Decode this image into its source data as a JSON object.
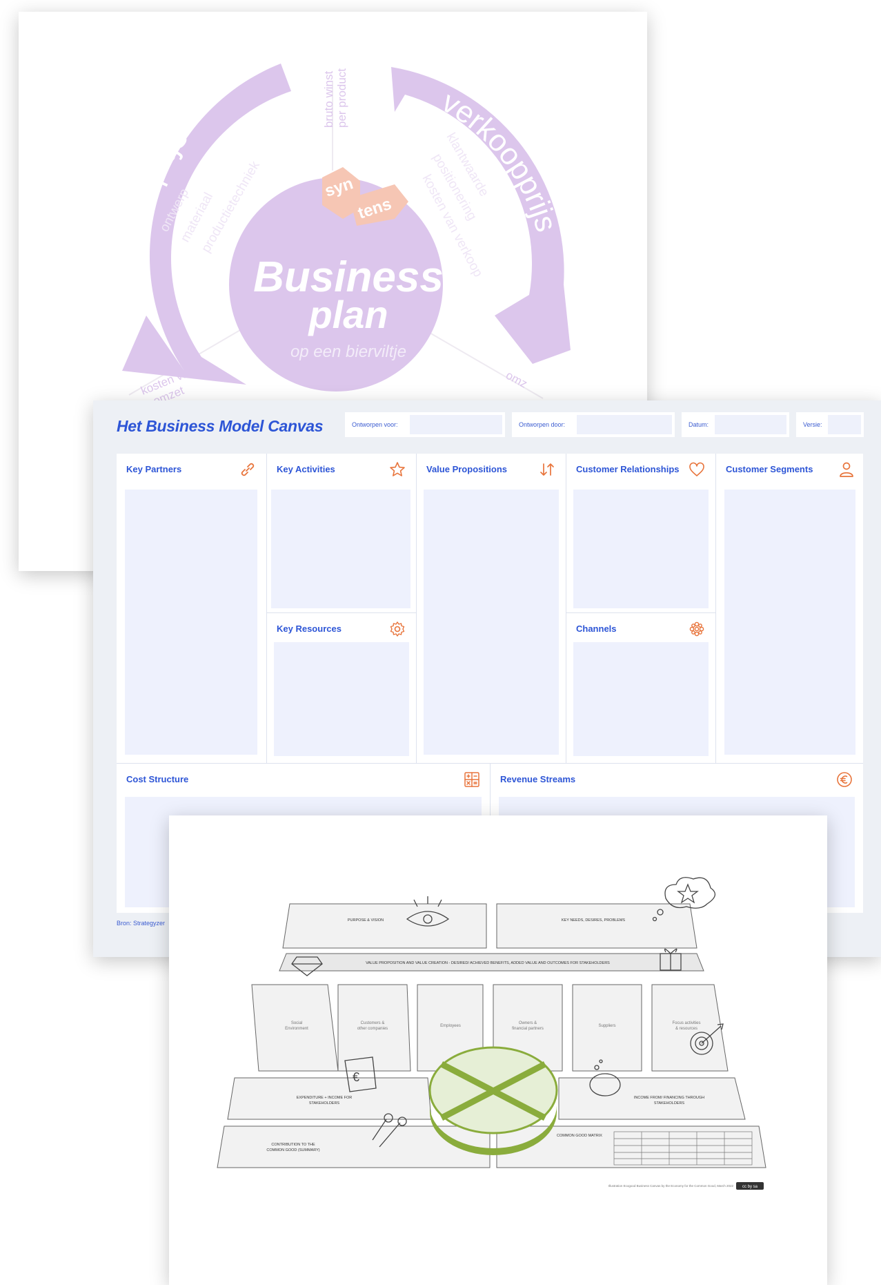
{
  "business_plan": {
    "title_line1": "Business",
    "title_line2": "plan",
    "subtitle": "op een bierviltje",
    "logo_top": "syn",
    "logo_bottom": "tens",
    "arc_left": "kostprijs",
    "arc_right": "verkoopprijs",
    "left_items": [
      "ontwerp",
      "materiaal",
      "productietechniek"
    ],
    "right_items": [
      "klantwaarde",
      "positionering",
      "kosten van verkoop"
    ],
    "top_label_1": "bruto winst",
    "top_label_2": "per product",
    "bottom_left_1": "kosten van",
    "bottom_left_2": "omzet",
    "bottom_right": "omz"
  },
  "bmc": {
    "title": "Het Business Model Canvas",
    "meta": {
      "designed_for": "Ontworpen voor:",
      "designed_by": "Ontworpen door:",
      "date": "Datum:",
      "version": "Versie:"
    },
    "blocks": {
      "key_partners": "Key Partners",
      "key_activities": "Key Activities",
      "key_resources": "Key Resources",
      "value_propositions": "Value Propositions",
      "customer_relationships": "Customer Relationships",
      "channels": "Channels",
      "customer_segments": "Customer Segments",
      "cost_structure": "Cost Structure",
      "revenue_streams": "Revenue Streams"
    },
    "source": "Bron: Strategyzer",
    "accent_blue": "#2d55d6",
    "icon_orange": "#e8743b",
    "icons": [
      "link-icon",
      "star-icon",
      "swap-arrows-icon",
      "heart-icon",
      "person-icon",
      "gear-icon",
      "flower-icon",
      "calculator-icon",
      "euro-icon"
    ]
  },
  "common_good": {
    "purpose": "PURPOSE & VISION",
    "needs": "KEY NEEDS, DESIRES, PROBLEMS",
    "value_prop": "VALUE PROPOSITION AND VALUE CREATION - DESIRED/ ACHIEVED BENEFITS, ADDED VALUE AND OUTCOMES FOR STAKEHOLDERS",
    "stakeholders": [
      [
        "Social",
        "Environment"
      ],
      [
        "Customers &",
        "other companies"
      ],
      [
        "Employees"
      ],
      [
        "Owners &",
        "financial partners"
      ],
      [
        "Suppliers"
      ],
      [
        "Focus activities",
        "& resources"
      ]
    ],
    "expenditure": [
      "EXPENDITURE + INCOME FOR",
      "STAKEHOLDERS"
    ],
    "income": [
      "INCOME FROM/ FINANCING THROUGH",
      "STAKEHOLDERS"
    ],
    "contribution": [
      "CONTRIBUTION TO THE",
      "COMMON GOOD (SUMMARY)"
    ],
    "matrix_title": "COMMON GOOD MATRIX",
    "footer": "Illustration Ecogood Business Canvas by the Economy for the Common Good, March 2022",
    "license": "cc by sa",
    "green": "#8aac3c"
  }
}
